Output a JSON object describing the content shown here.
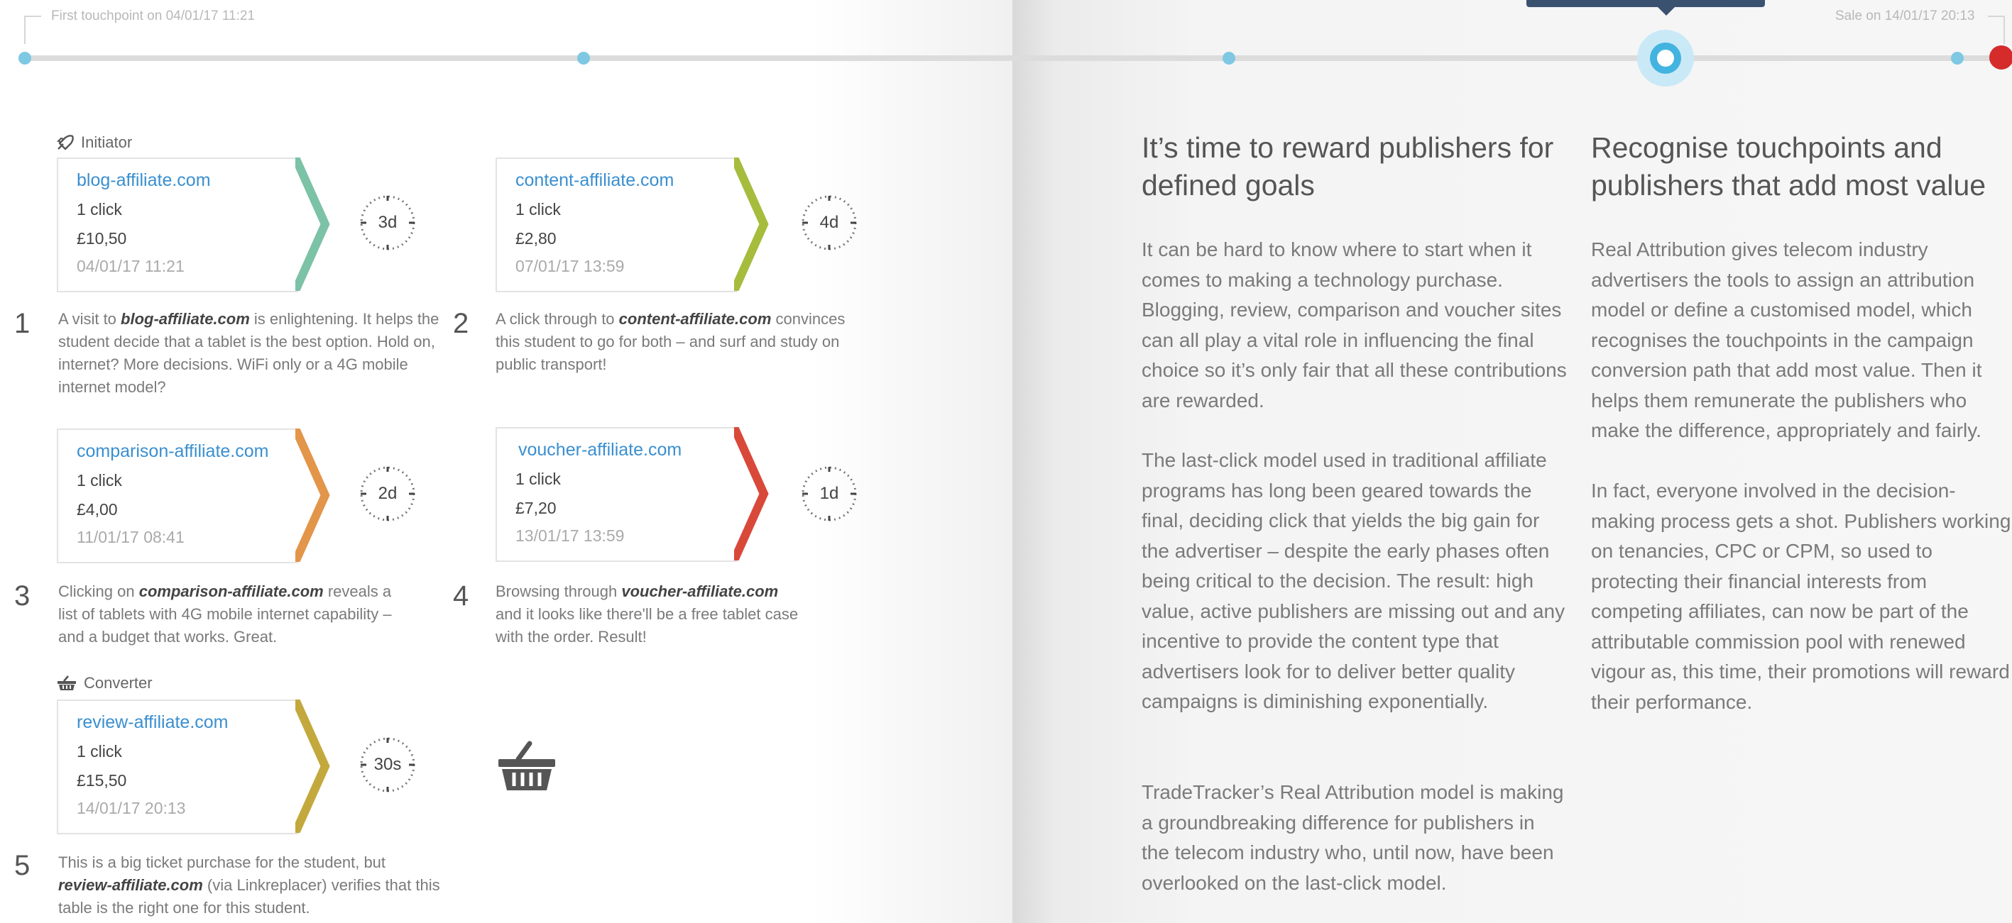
{
  "timeline": {
    "start_label": "First touchpoint on 04/01/17 11:21",
    "end_label": "Sale on 14/01/17 20:13"
  },
  "roles": {
    "initiator": "Initiator",
    "converter": "Converter"
  },
  "cards": [
    {
      "domain": "blog-affiliate.com",
      "clicks": "1 click",
      "value": "£10,50",
      "date": "04/01/17 11:21",
      "wait": "3d",
      "color": "#7cc2a6"
    },
    {
      "domain": "content-affiliate.com",
      "clicks": "1 click",
      "value": "£2,80",
      "date": "07/01/17 13:59",
      "wait": "4d",
      "color": "#a6bc3d"
    },
    {
      "domain": "comparison-affiliate.com",
      "clicks": "1 click",
      "value": "£4,00",
      "date": "11/01/17 08:41",
      "wait": "2d",
      "color": "#e3954a"
    },
    {
      "domain": "voucher-affiliate.com",
      "clicks": "1 click",
      "value": "£7,20",
      "date": "13/01/17 13:59",
      "wait": "1d",
      "color": "#d9493a"
    },
    {
      "domain": "review-affiliate.com",
      "clicks": "1 click",
      "value": "£15,50",
      "date": "14/01/17 20:13",
      "wait": "30s",
      "color": "#c3a93d"
    }
  ],
  "steps": [
    {
      "num": "1",
      "pre": "A visit to ",
      "bold": "blog-affiliate.com",
      "post": " is enlightening. It helps the student decide that a tablet is the best option. Hold on, internet? More decisions. WiFi only or a 4G mobile internet model?"
    },
    {
      "num": "2",
      "pre": "A click through to ",
      "bold": "content-affiliate.com",
      "post": " convinces this student to go for both – and surf and study on public transport!"
    },
    {
      "num": "3",
      "pre": "Clicking on ",
      "bold": "comparison-affiliate.com",
      "post": " reveals a list of tablets with 4G mobile internet capability – and a budget that works. Great."
    },
    {
      "num": "4",
      "pre": "Browsing through ",
      "bold": "voucher-affiliate.com",
      "post": " and it looks like there'll be a free tablet case with the order. Result!"
    },
    {
      "num": "5",
      "pre": "This is a big ticket purchase for the student, but ",
      "bold": "review-affiliate.com",
      "post": " (via Linkreplacer) verifies that this table is the right one for this student."
    }
  ],
  "article": {
    "col1_heading": "It’s time to reward publishers for defined goals",
    "col1_paragraphs": [
      "It can be hard to know where to start when it comes to making a technology purchase. Blogging, review, comparison and voucher sites can all play a vital role in influencing the final choice so it’s only fair that all these contributions are rewarded.",
      "The last-click model used in traditional affiliate programs has long been geared towards the final, deciding click that yields the big gain for the advertiser – despite the early phases often being critical to the decision. The result: high value, active publishers are missing out and any incentive to provide the content type that advertisers look for to deliver better quality campaigns is diminishing exponentially.",
      "TradeTracker’s Real Attribution model is making a groundbreaking difference for publishers in the telecom industry who, until now, have been overlooked on the last-click model."
    ],
    "col2_heading": "Recognise touchpoints and publishers that add most value",
    "col2_paragraphs": [
      "Real Attribution gives telecom industry advertisers the tools to assign an attribution model or define a customised model, which recognises the touchpoints in the campaign conversion path that add most value. Then it helps them remunerate the publishers who make the difference, appropriately and fairly.",
      "In fact, everyone involved in the decision-making process gets a shot. Publishers working on tenancies, CPC or CPM, so used to protecting their financial interests from competing affiliates, can now be part of the attributable commission pool with renewed vigour as, this time, their promotions will reward their performance."
    ]
  },
  "icons": {
    "initiator": "rocket-icon",
    "converter": "basket-icon",
    "timer": "stopwatch-icon",
    "final": "shopping-basket-icon"
  }
}
